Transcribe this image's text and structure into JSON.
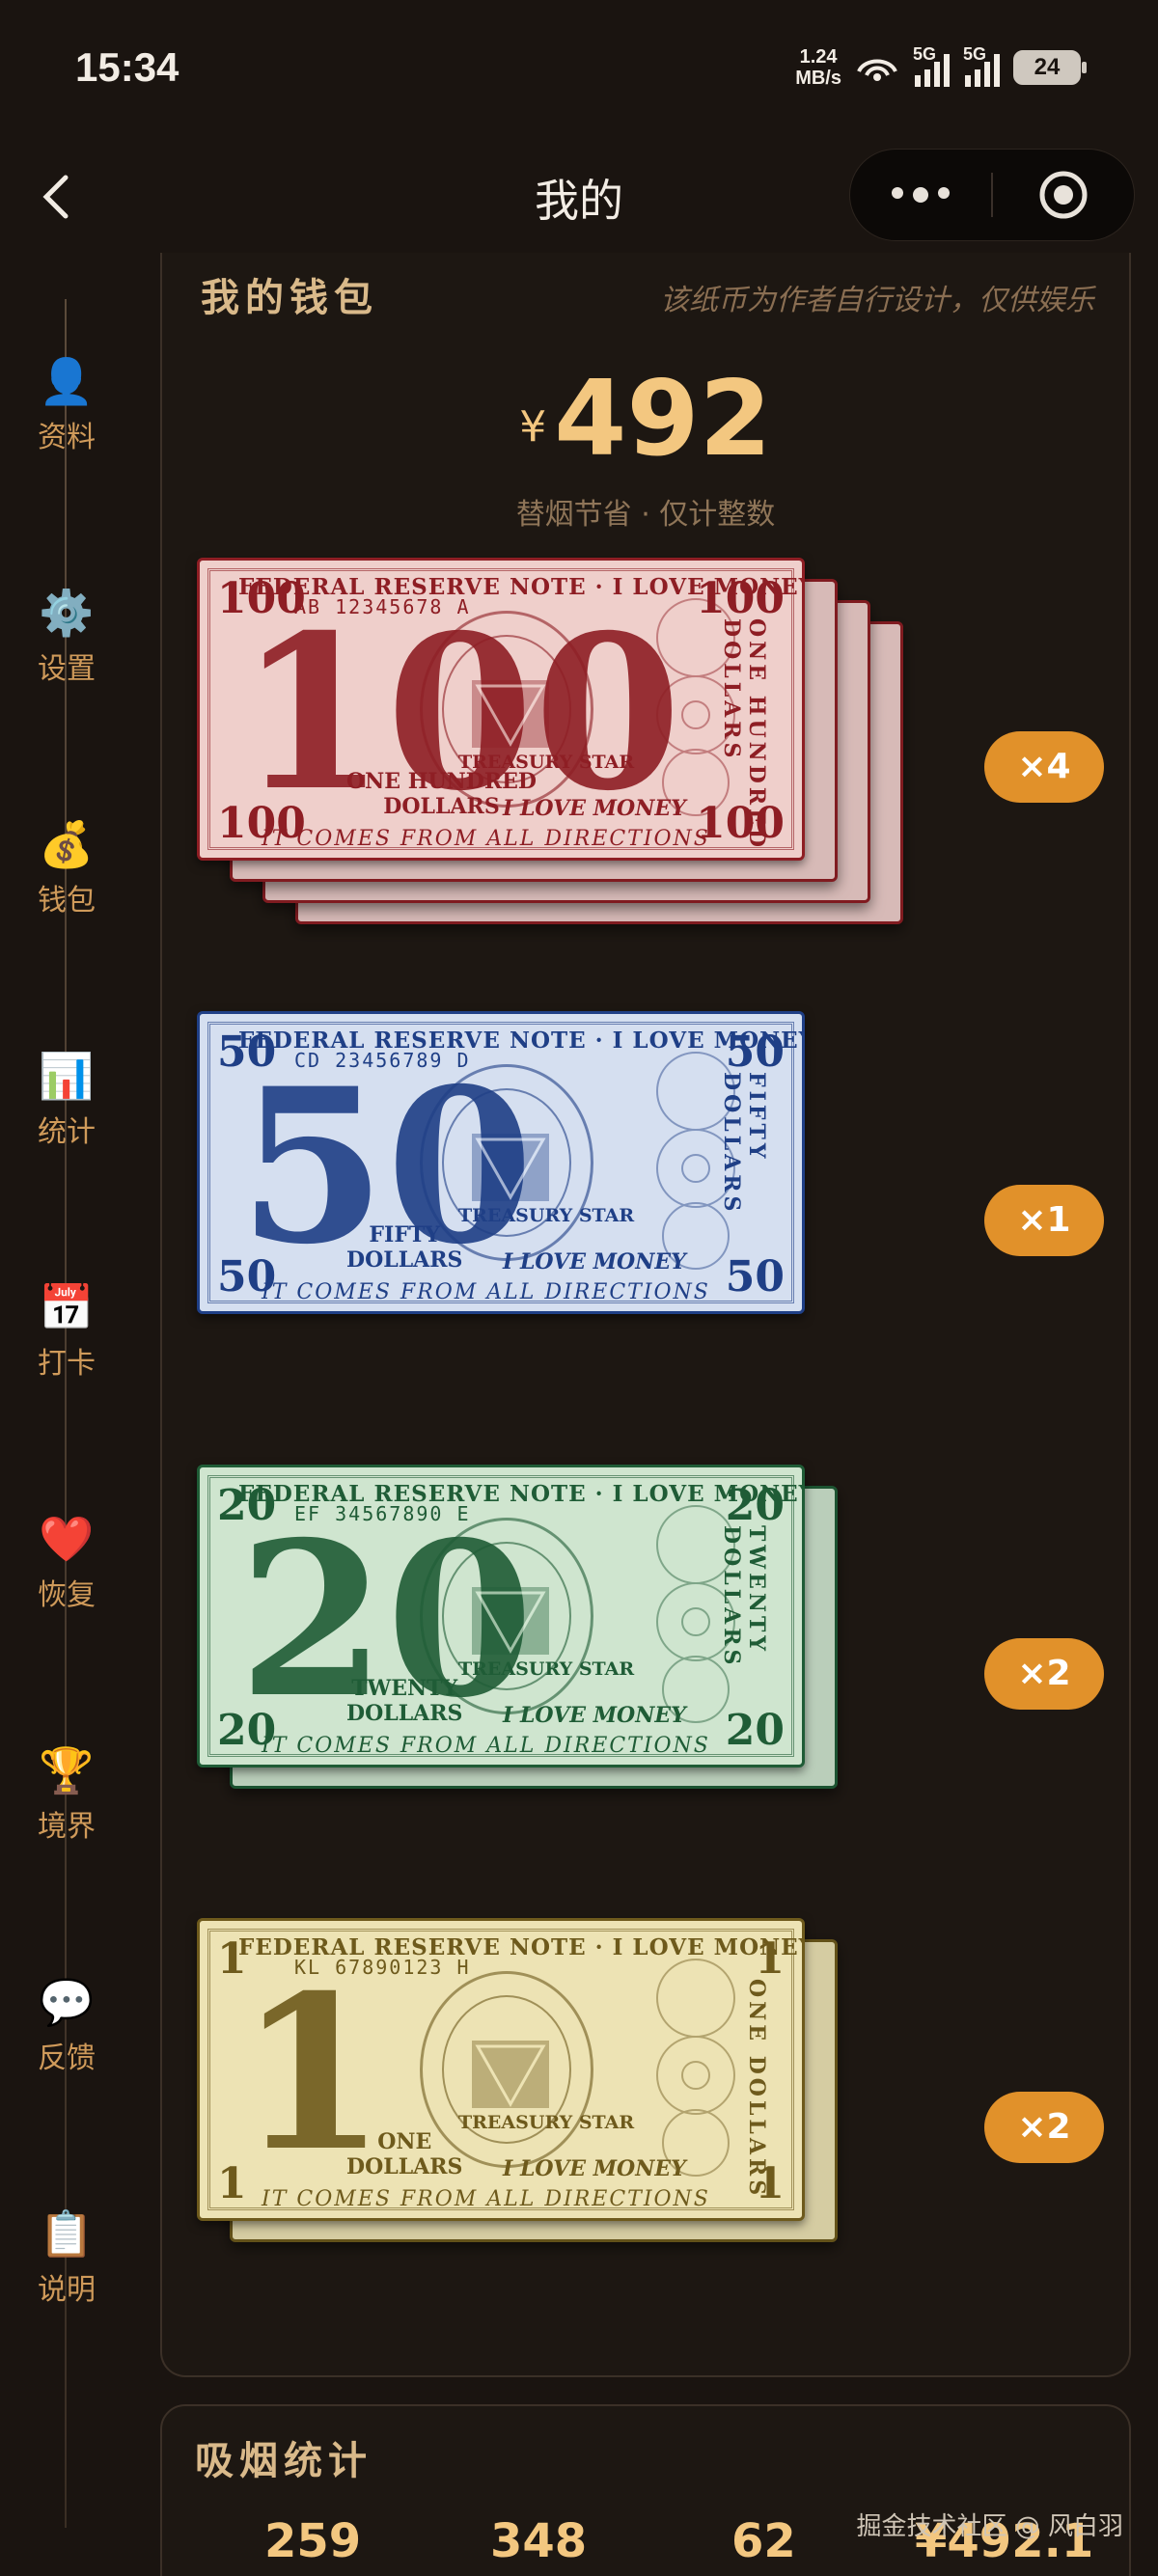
{
  "status": {
    "time": "15:34",
    "net_speed_value": "1.24",
    "net_speed_unit": "MB/s",
    "sim1": "5G",
    "sim2": "5G",
    "battery": "24"
  },
  "nav": {
    "title": "我的"
  },
  "sidebar": {
    "items": [
      {
        "icon": "👤",
        "label": "资料"
      },
      {
        "icon": "⚙️",
        "label": "设置"
      },
      {
        "icon": "💰",
        "label": "钱包"
      },
      {
        "icon": "📊",
        "label": "统计"
      },
      {
        "icon": "📅",
        "label": "打卡"
      },
      {
        "icon": "❤️",
        "label": "恢复"
      },
      {
        "icon": "🏆",
        "label": "境界"
      },
      {
        "icon": "💬",
        "label": "反馈"
      },
      {
        "icon": "📋",
        "label": "说明"
      }
    ]
  },
  "wallet": {
    "title": "我的钱包",
    "note": "该纸币为作者自行设计，仅供娱乐",
    "currency": "¥",
    "amount": "492",
    "subtitle": "替烟节省 · 仅计整数",
    "notes": [
      {
        "denom": "100",
        "word": "ONE HUNDRED",
        "word2": "DOLLARS",
        "side": "ONE HUNDRED DOLLARS",
        "serial": "AB 12345678 A",
        "count": "×4",
        "color": "#8e1e24",
        "bg": "#efcfcb"
      },
      {
        "denom": "50",
        "word": "FIFTY",
        "word2": "DOLLARS",
        "side": "FIFTY DOLLARS",
        "serial": "CD 23456789 D",
        "count": "×1",
        "color": "#1f3f86",
        "bg": "#d5dff0"
      },
      {
        "denom": "20",
        "word": "TWENTY",
        "word2": "DOLLARS",
        "side": "TWENTY DOLLARS",
        "serial": "EF 34567890 E",
        "count": "×2",
        "color": "#1f5c36",
        "bg": "#cfe5cf"
      },
      {
        "denom": "1",
        "word": "ONE",
        "word2": "DOLLARS",
        "side": "ONE DOLLARS",
        "serial": "KL 67890123 H",
        "count": "×2",
        "color": "#6e5a1c",
        "bg": "#ede3b4"
      }
    ],
    "note_header": "FEDERAL RESERVE NOTE · I LOVE MONEY",
    "note_footer1": "I LOVE MONEY",
    "note_footer2": "IT COMES FROM ALL DIRECTIONS",
    "note_treasury": "TREASURY STAR"
  },
  "smoke": {
    "title": "吸烟统计",
    "stats": [
      "259",
      "348",
      "62",
      "¥492.1"
    ]
  },
  "watermark": "掘金技术社区 @ 风白羽"
}
